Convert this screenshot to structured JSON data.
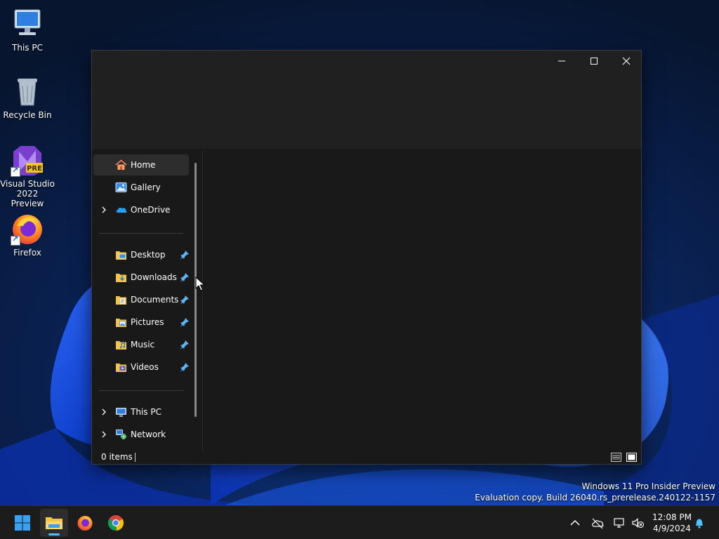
{
  "desktop": {
    "icons": [
      {
        "label": "This PC",
        "icon": "computer-icon"
      },
      {
        "label": "Recycle Bin",
        "icon": "recycle-bin-icon"
      },
      {
        "label": "Visual Studio 2022 Preview",
        "icon": "visual-studio-icon",
        "badge": "PRE"
      },
      {
        "label": "Firefox",
        "icon": "firefox-icon"
      }
    ]
  },
  "explorer": {
    "nav": {
      "items": [
        {
          "label": "Home",
          "icon": "home-icon",
          "selected": true
        },
        {
          "label": "Gallery",
          "icon": "gallery-icon"
        },
        {
          "label": "OneDrive",
          "icon": "onedrive-icon",
          "expandable": true
        }
      ],
      "quick_access": [
        {
          "label": "Desktop",
          "icon": "desktop-folder-icon",
          "pinned": true
        },
        {
          "label": "Downloads",
          "icon": "downloads-folder-icon",
          "pinned": true
        },
        {
          "label": "Documents",
          "icon": "documents-folder-icon",
          "pinned": true
        },
        {
          "label": "Pictures",
          "icon": "pictures-folder-icon",
          "pinned": true
        },
        {
          "label": "Music",
          "icon": "music-folder-icon",
          "pinned": true
        },
        {
          "label": "Videos",
          "icon": "videos-folder-icon",
          "pinned": true
        }
      ],
      "locations": [
        {
          "label": "This PC",
          "icon": "this-pc-icon",
          "expandable": true
        },
        {
          "label": "Network",
          "icon": "network-icon",
          "expandable": true
        }
      ]
    },
    "status": {
      "item_count": "0 items"
    }
  },
  "watermark": {
    "line1": "Windows 11 Pro Insider Preview",
    "line2": "Evaluation copy. Build 26040.rs_prerelease.240122-1157"
  },
  "taskbar": {
    "apps": [
      {
        "name": "start",
        "icon": "windows-start-icon"
      },
      {
        "name": "file-explorer",
        "icon": "file-explorer-icon",
        "active": true
      },
      {
        "name": "firefox",
        "icon": "firefox-icon"
      },
      {
        "name": "chrome",
        "icon": "chrome-icon"
      }
    ],
    "tray_icons": [
      "chevron-up-icon",
      "cloud-off-icon",
      "network-icon",
      "speaker-muted-icon",
      "notification-bell-icon"
    ]
  },
  "clock": {
    "time": "12:08 PM",
    "date": "4/9/2024"
  },
  "colors": {
    "window_bg": "#191919",
    "titlebar_bg": "#202020",
    "taskbar_bg": "#1c1c1c",
    "accent": "#4cc2ff",
    "selection_bg": "#2d2d2d"
  }
}
